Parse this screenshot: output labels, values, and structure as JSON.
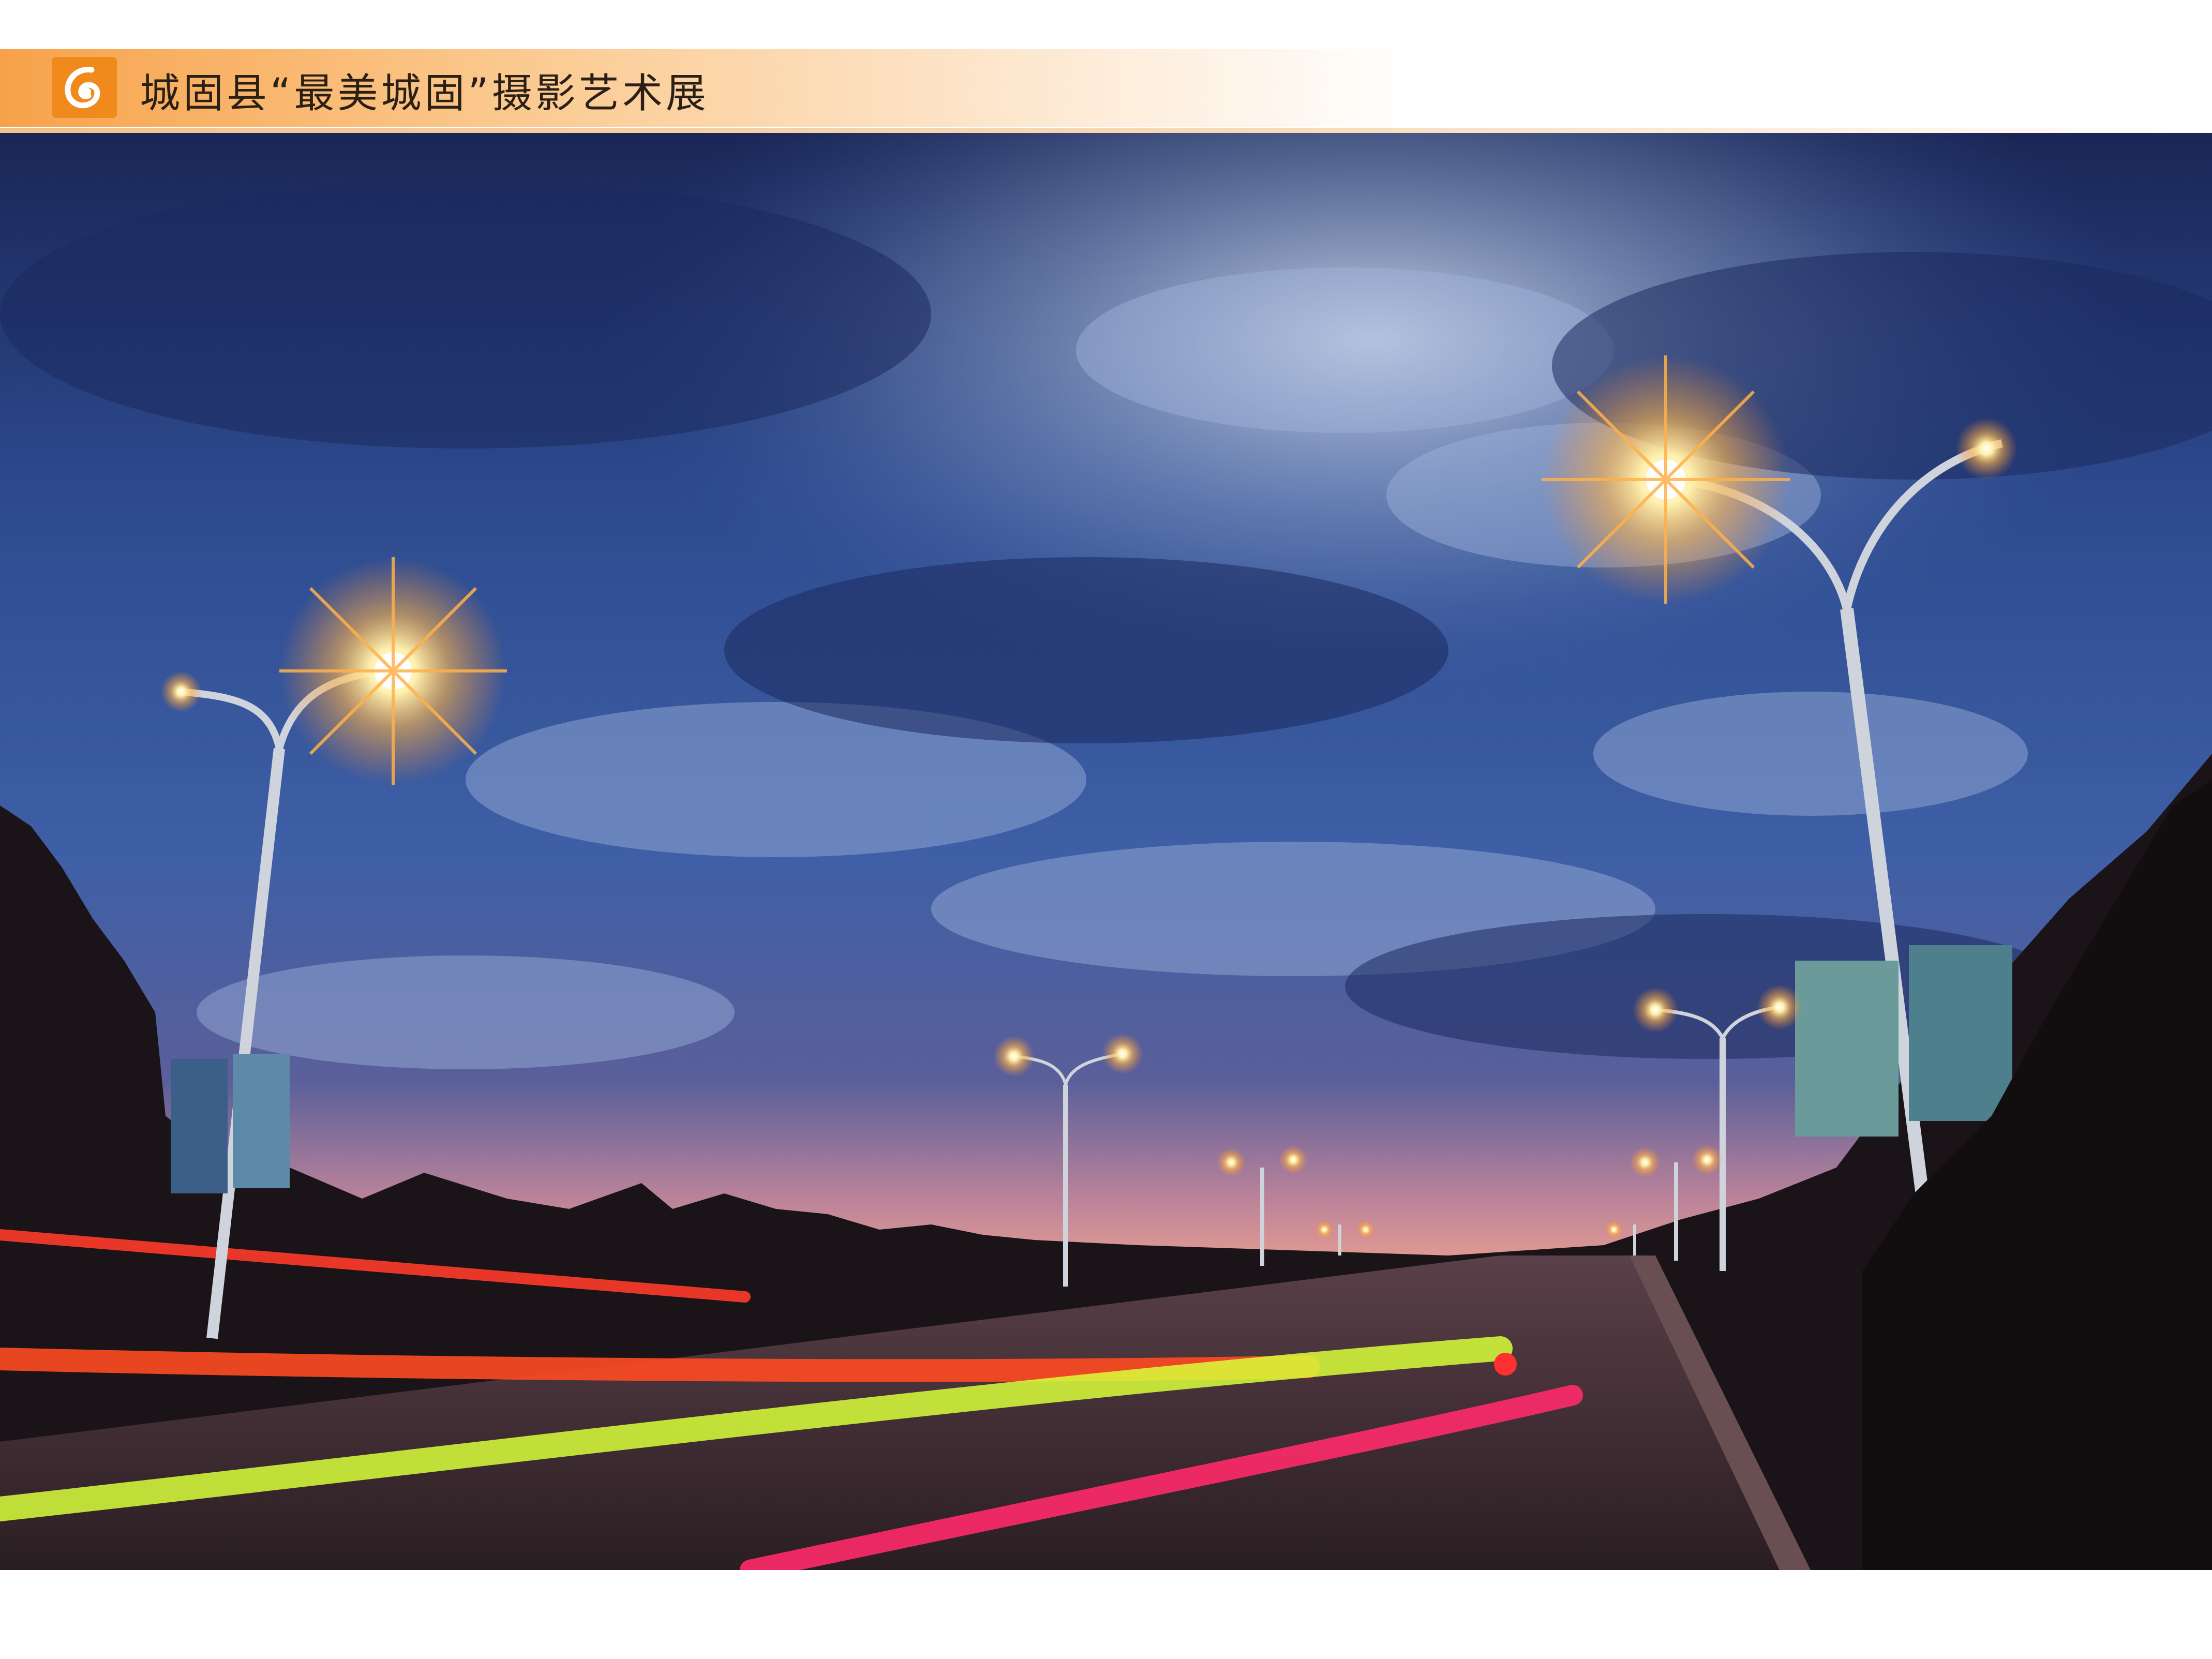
{
  "header": {
    "logo_icon": "orange-logo-icon",
    "title": "城固县“最美城固”摄影艺术展",
    "accent_color": "#f08a1c"
  },
  "photo": {
    "subject": "street-at-dusk-photo",
    "colors": {
      "sky_top": "#1e2c62",
      "sky_mid": "#3b5aa0",
      "horizon": "#e7a08c",
      "road": "#3a2a2c",
      "streetlight": "#ffd27a",
      "light_trail_red": "#ff3b2a",
      "light_trail_yellow": "#d8ff3a",
      "light_trail_pink": "#ff2a6a"
    }
  }
}
